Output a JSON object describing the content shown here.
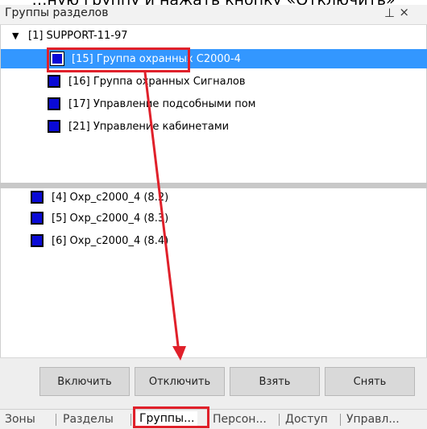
{
  "caption_top": "…ную группу и нажать кнопку «Отключить»",
  "panel": {
    "title": "Группы разделов",
    "pin_icon": "⊥",
    "close_icon": "×"
  },
  "tree": {
    "root_label": "[1] SUPPORT-11-97",
    "items": [
      {
        "label": "[15] Группа охранных С2000-4",
        "selected": true
      },
      {
        "label": "[16] Группа охранных Сигналов"
      },
      {
        "label": "[17] Управление подсобными пом"
      },
      {
        "label": "[21] Управление кабинетами"
      }
    ]
  },
  "list": {
    "items": [
      {
        "label": "[4] Охр_с2000_4 (8.2)"
      },
      {
        "label": "[5] Охр_с2000_4 (8.3)"
      },
      {
        "label": "[6] Охр_с2000_4 (8.4)"
      }
    ]
  },
  "buttons": {
    "enable": "Включить",
    "disable": "Отключить",
    "take": "Взять",
    "remove": "Снять"
  },
  "tabs": [
    "Зоны",
    "Разделы",
    "Группы...",
    "Персон...",
    "Доступ",
    "Управл..."
  ],
  "colors": {
    "selection": "#3397ff",
    "group_icon": "#0a0ad6",
    "annotation": "#e0202a"
  }
}
